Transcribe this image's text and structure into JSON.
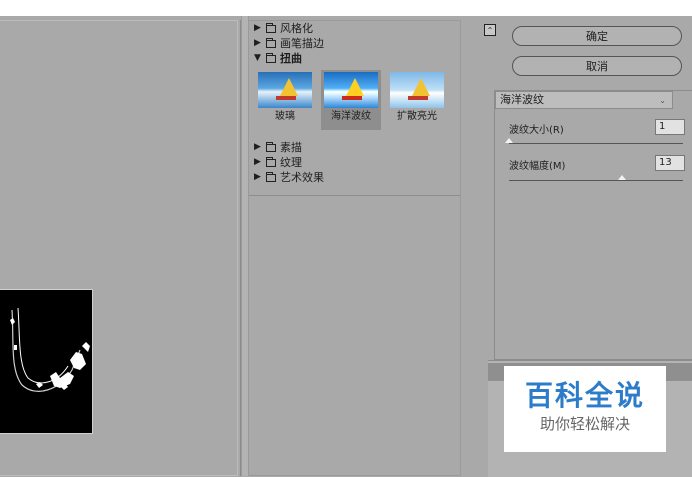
{
  "gallery": {
    "categories": [
      {
        "label": "风格化",
        "open": false
      },
      {
        "label": "画笔描边",
        "open": false
      },
      {
        "label": "扭曲",
        "open": true
      },
      {
        "label": "素描",
        "open": false
      },
      {
        "label": "纹理",
        "open": false
      },
      {
        "label": "艺术效果",
        "open": false
      }
    ],
    "thumbnails": [
      {
        "label": "玻璃",
        "selected": false
      },
      {
        "label": "海洋波纹",
        "selected": true
      },
      {
        "label": "扩散亮光",
        "selected": false
      }
    ]
  },
  "right": {
    "ok_label": "确定",
    "cancel_label": "取消",
    "filter_select": "海洋波纹",
    "params": [
      {
        "label": "波纹大小(R)",
        "value": "1",
        "slider_fraction": 0.0
      },
      {
        "label": "波纹幅度(M)",
        "value": "13",
        "slider_fraction": 0.65
      }
    ]
  },
  "watermark": {
    "title": "百科全说",
    "subtitle": "助你轻松解决"
  },
  "colors": {
    "panel": "#a9a9a9",
    "watermark_blue": "#2d7cc9"
  }
}
